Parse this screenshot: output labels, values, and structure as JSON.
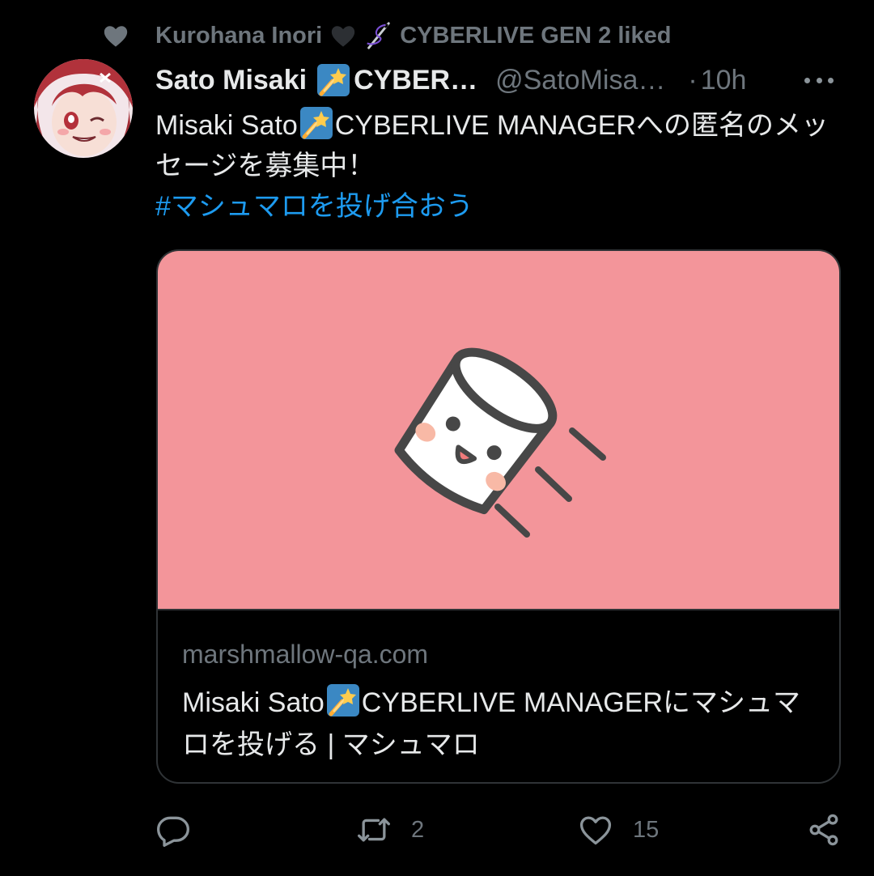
{
  "social_context": {
    "name": "Kurohana Inori",
    "suffix": "CYBERLIVE GEN 2 liked"
  },
  "tweet": {
    "display_name": "Sato Misaki",
    "name_suffix": "CYBER…",
    "handle": "@SatoMisa…",
    "separator": "·",
    "timestamp": "10h",
    "text_line1_a": "Misaki Sato",
    "text_line1_b": "CYBERLIVE MANAGERへの匿名のメッセージを募集中！",
    "hashtag": "#マシュマロを投げ合おう"
  },
  "card": {
    "domain": "marshmallow-qa.com",
    "title_a": "Misaki Sato",
    "title_b": "CYBERLIVE MANAGERにマシュマロを投げる | マシュマロ"
  },
  "actions": {
    "replies": "",
    "retweets": "2",
    "likes": "15"
  },
  "icons": {
    "social_heart": "heart-filled-icon",
    "black_heart": "black-heart-emoji",
    "needle": "sewing-needle-emoji",
    "badge": "shooting-star-badge-icon",
    "more": "more-horizontal-icon",
    "reply": "reply-icon",
    "retweet": "retweet-icon",
    "like": "heart-outline-icon",
    "share": "share-icon"
  },
  "colors": {
    "background": "#000000",
    "text_primary": "#e7e9ea",
    "text_secondary": "#6e767d",
    "link": "#1d9bf0",
    "card_image_bg": "#f3959a",
    "border": "#2f3336"
  }
}
